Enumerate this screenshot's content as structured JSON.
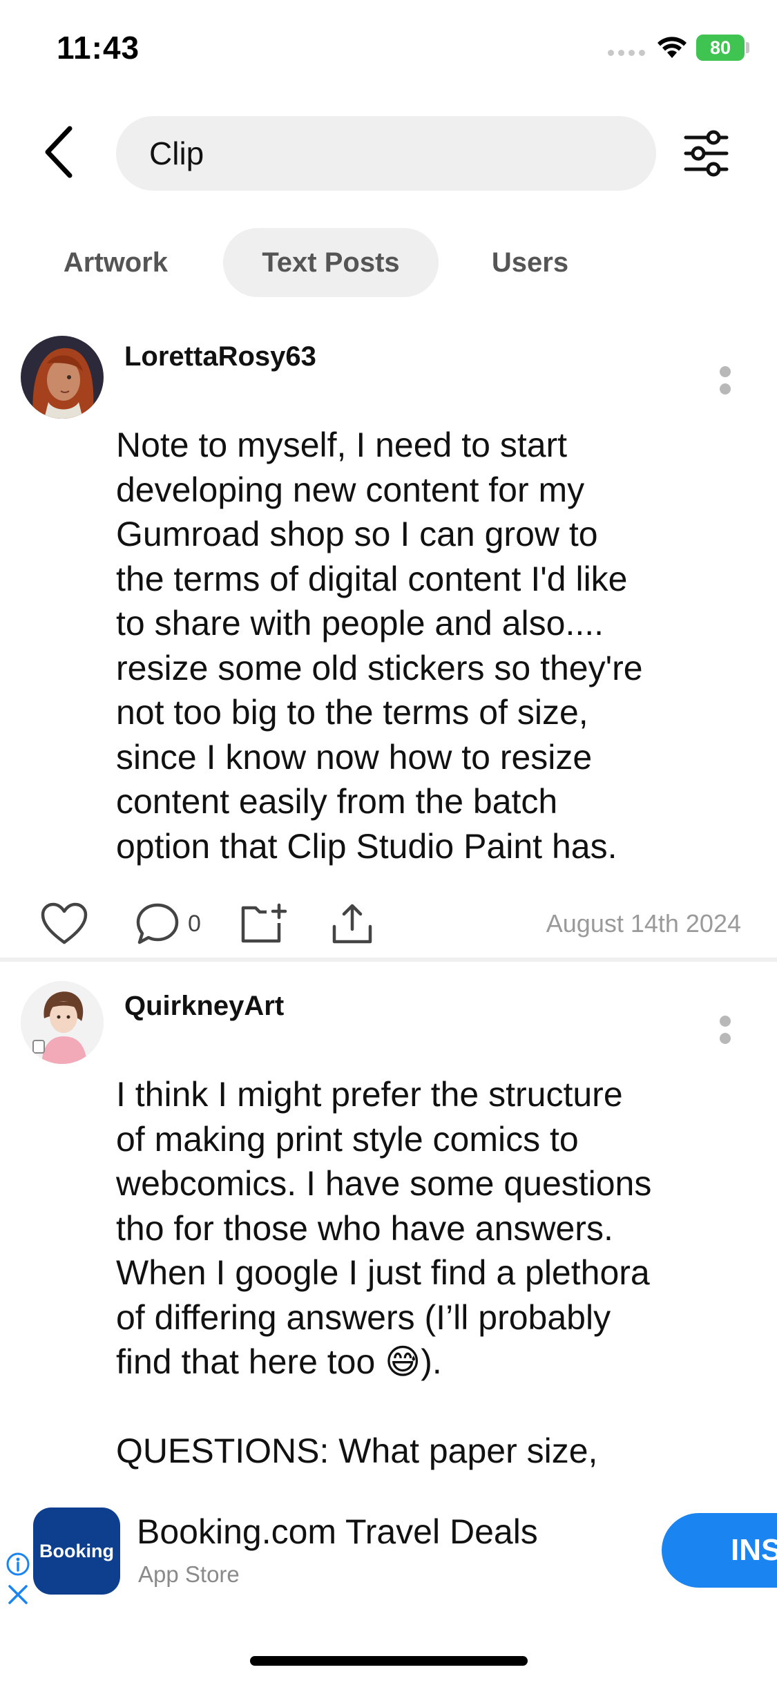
{
  "status_bar": {
    "time": "11:43",
    "battery": "80"
  },
  "search": {
    "value": "Clip"
  },
  "tabs": [
    {
      "label": "Artwork",
      "active": false
    },
    {
      "label": "Text Posts",
      "active": true
    },
    {
      "label": "Users",
      "active": false
    }
  ],
  "posts": [
    {
      "username": "LorettaRosy63",
      "body": "Note to myself, I need to start\ndeveloping new content for my\nGumroad shop so I can grow to\nthe terms of digital content I'd like\nto share with people and also....\nresize some old stickers so they're\nnot too big to the terms of size,\nsince I know now how to resize\ncontent easily from the batch\noption that Clip Studio Paint has.",
      "comments": "0",
      "date": "August 14th 2024"
    },
    {
      "username": "QuirkneyArt",
      "body": "I think I might prefer the structure\nof making print style comics to\nwebcomics. I have some questions\ntho for those who have answers.\nWhen I google I just find a plethora\nof differing answers (I’ll probably\nfind that here too 😅).\n\nQUESTIONS: What paper size,"
    }
  ],
  "ad": {
    "logo_text": "Booking",
    "title": "Booking.com Travel Deals",
    "subtitle": "App Store",
    "install_label": "INSTALL"
  },
  "colors": {
    "battery": "#3fc452",
    "install_button": "#1a84f0",
    "ad_logo": "#0e3f8f"
  }
}
